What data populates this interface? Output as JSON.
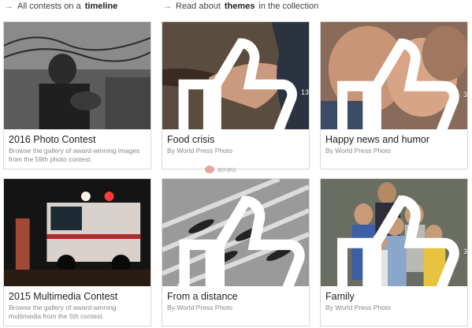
{
  "nav": {
    "timeline_prefix": "All contests on a",
    "timeline_bold": "timeline",
    "themes_prefix": "Read about",
    "themes_bold": "themes",
    "themes_suffix": "in the collection"
  },
  "cards": [
    {
      "title": "2016 Photo Contest",
      "desc": "Browse the gallery of award-winning images from the 59th photo contest.",
      "likes": "",
      "icon": "photo-image"
    },
    {
      "title": "Food crisis",
      "desc": "By World Press Photo",
      "likes": "13",
      "icon": "thumbs-up-icon"
    },
    {
      "title": "Happy news and humor",
      "desc": "By World Press Photo",
      "likes": "3",
      "icon": "thumbs-up-icon"
    },
    {
      "title": "2015 Multimedia Contest",
      "desc": "Browse the gallery of award-winning multimedia from the 5th contest.",
      "likes": "",
      "icon": "photo-image"
    },
    {
      "title": "From a distance",
      "desc": "By World Press Photo",
      "likes": "",
      "icon": "thumbs-up-icon"
    },
    {
      "title": "Family",
      "desc": "By World Press Photo",
      "likes": "3",
      "icon": "thumbs-up-icon"
    }
  ],
  "watermark": "國外網站"
}
